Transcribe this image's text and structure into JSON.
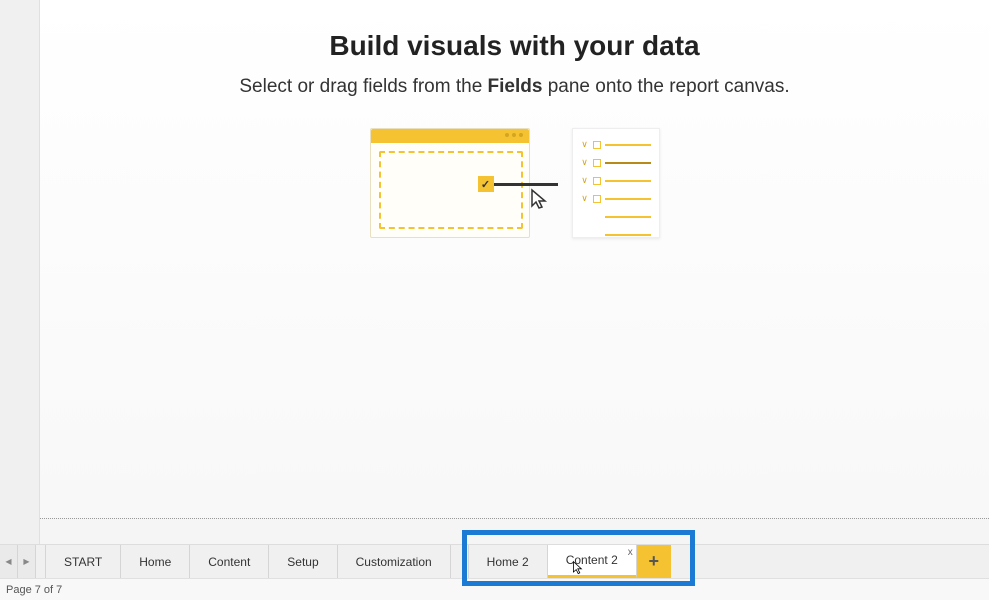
{
  "empty_state": {
    "title": "Build visuals with your data",
    "subtitle_before": "Select or drag fields from the ",
    "subtitle_bold": "Fields",
    "subtitle_after": " pane onto the report canvas."
  },
  "tabs": {
    "nav_prev": "◀",
    "nav_next": "▶",
    "items": [
      {
        "label": "START",
        "active": false
      },
      {
        "label": "Home",
        "active": false
      },
      {
        "label": "Content",
        "active": false
      },
      {
        "label": "Setup",
        "active": false
      },
      {
        "label": "Customization",
        "active": false
      },
      {
        "label": "Home 2",
        "active": false
      },
      {
        "label": "Content 2",
        "active": true
      }
    ],
    "add_symbol": "+",
    "close_symbol": "x"
  },
  "status": {
    "page_label": "Page 7 of 7"
  }
}
